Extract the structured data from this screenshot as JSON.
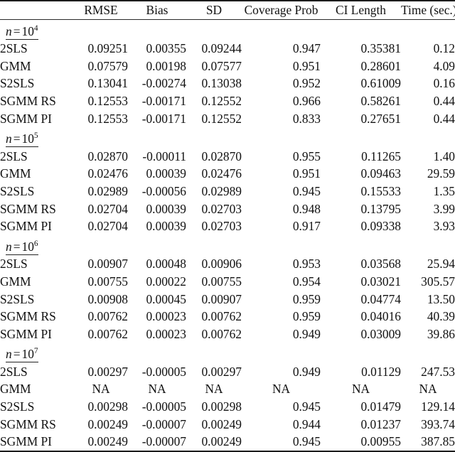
{
  "table": {
    "columns": [
      {
        "key": "method",
        "label": ""
      },
      {
        "key": "rmse",
        "label": "RMSE"
      },
      {
        "key": "bias",
        "label": "Bias"
      },
      {
        "key": "sd",
        "label": "SD"
      },
      {
        "key": "coverage",
        "label": "Coverage Prob"
      },
      {
        "key": "ci_length",
        "label": "CI Length"
      },
      {
        "key": "time",
        "label": "Time (sec.)"
      }
    ],
    "sections": [
      {
        "label_prefix": "n",
        "label_eq": "=",
        "label_base": "10",
        "label_exp": "4",
        "label_text": "n = 10^4",
        "rows": [
          {
            "method": "2SLS",
            "rmse": "0.09251",
            "bias": "0.00355",
            "sd": "0.09244",
            "coverage": "0.947",
            "ci_length": "0.35381",
            "time": "0.12"
          },
          {
            "method": "GMM",
            "rmse": "0.07579",
            "bias": "0.00198",
            "sd": "0.07577",
            "coverage": "0.951",
            "ci_length": "0.28601",
            "time": "4.09"
          },
          {
            "method": "S2SLS",
            "rmse": "0.13041",
            "bias": "-0.00274",
            "sd": "0.13038",
            "coverage": "0.952",
            "ci_length": "0.61009",
            "time": "0.16"
          },
          {
            "method": "SGMM RS",
            "rmse": "0.12553",
            "bias": "-0.00171",
            "sd": "0.12552",
            "coverage": "0.966",
            "ci_length": "0.58261",
            "time": "0.44"
          },
          {
            "method": "SGMM PI",
            "rmse": "0.12553",
            "bias": "-0.00171",
            "sd": "0.12552",
            "coverage": "0.833",
            "ci_length": "0.27651",
            "time": "0.44"
          }
        ]
      },
      {
        "label_prefix": "n",
        "label_eq": "=",
        "label_base": "10",
        "label_exp": "5",
        "label_text": "n = 10^5",
        "rows": [
          {
            "method": "2SLS",
            "rmse": "0.02870",
            "bias": "-0.00011",
            "sd": "0.02870",
            "coverage": "0.955",
            "ci_length": "0.11265",
            "time": "1.40"
          },
          {
            "method": "GMM",
            "rmse": "0.02476",
            "bias": "0.00039",
            "sd": "0.02476",
            "coverage": "0.951",
            "ci_length": "0.09463",
            "time": "29.59"
          },
          {
            "method": "S2SLS",
            "rmse": "0.02989",
            "bias": "-0.00056",
            "sd": "0.02989",
            "coverage": "0.945",
            "ci_length": "0.15533",
            "time": "1.35"
          },
          {
            "method": "SGMM RS",
            "rmse": "0.02704",
            "bias": "0.00039",
            "sd": "0.02703",
            "coverage": "0.948",
            "ci_length": "0.13795",
            "time": "3.99"
          },
          {
            "method": "SGMM PI",
            "rmse": "0.02704",
            "bias": "0.00039",
            "sd": "0.02703",
            "coverage": "0.917",
            "ci_length": "0.09338",
            "time": "3.93"
          }
        ]
      },
      {
        "label_prefix": "n",
        "label_eq": "=",
        "label_base": "10",
        "label_exp": "6",
        "label_text": "n = 10^6",
        "rows": [
          {
            "method": "2SLS",
            "rmse": "0.00907",
            "bias": "0.00048",
            "sd": "0.00906",
            "coverage": "0.953",
            "ci_length": "0.03568",
            "time": "25.94"
          },
          {
            "method": "GMM",
            "rmse": "0.00755",
            "bias": "0.00022",
            "sd": "0.00755",
            "coverage": "0.954",
            "ci_length": "0.03021",
            "time": "305.57"
          },
          {
            "method": "S2SLS",
            "rmse": "0.00908",
            "bias": "0.00045",
            "sd": "0.00907",
            "coverage": "0.959",
            "ci_length": "0.04774",
            "time": "13.50"
          },
          {
            "method": "SGMM RS",
            "rmse": "0.00762",
            "bias": "0.00023",
            "sd": "0.00762",
            "coverage": "0.959",
            "ci_length": "0.04016",
            "time": "40.39"
          },
          {
            "method": "SGMM PI",
            "rmse": "0.00762",
            "bias": "0.00023",
            "sd": "0.00762",
            "coverage": "0.949",
            "ci_length": "0.03009",
            "time": "39.86"
          }
        ]
      },
      {
        "label_prefix": "n",
        "label_eq": "=",
        "label_base": "10",
        "label_exp": "7",
        "label_text": "n = 10^7",
        "rows": [
          {
            "method": "2SLS",
            "rmse": "0.00297",
            "bias": "-0.00005",
            "sd": "0.00297",
            "coverage": "0.949",
            "ci_length": "0.01129",
            "time": "247.53"
          },
          {
            "method": "GMM",
            "rmse": "NA",
            "bias": "NA",
            "sd": "NA",
            "coverage": "NA",
            "ci_length": "NA",
            "time": "NA",
            "na": true
          },
          {
            "method": "S2SLS",
            "rmse": "0.00298",
            "bias": "-0.00005",
            "sd": "0.00298",
            "coverage": "0.945",
            "ci_length": "0.01479",
            "time": "129.14"
          },
          {
            "method": "SGMM RS",
            "rmse": "0.00249",
            "bias": "-0.00007",
            "sd": "0.00249",
            "coverage": "0.944",
            "ci_length": "0.01237",
            "time": "393.74"
          },
          {
            "method": "SGMM PI",
            "rmse": "0.00249",
            "bias": "-0.00007",
            "sd": "0.00249",
            "coverage": "0.945",
            "ci_length": "0.00955",
            "time": "387.85"
          }
        ]
      }
    ]
  }
}
